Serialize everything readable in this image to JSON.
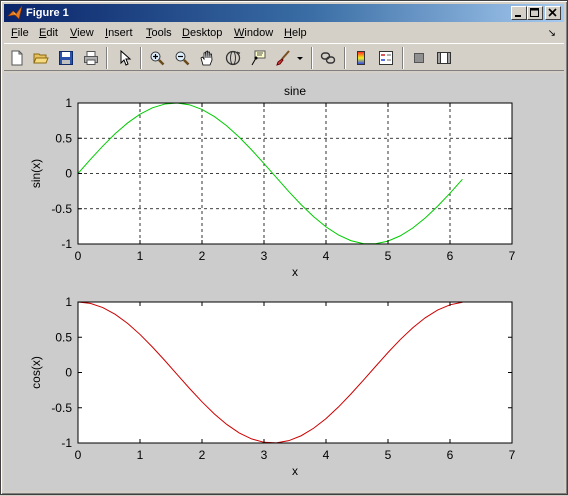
{
  "window": {
    "title": "Figure 1",
    "controls": {
      "minimize": "minimize",
      "maximize": "maximize",
      "close": "close"
    }
  },
  "menubar": {
    "items": [
      {
        "key": "F",
        "rest": "ile"
      },
      {
        "key": "E",
        "rest": "dit"
      },
      {
        "key": "V",
        "rest": "iew"
      },
      {
        "key": "I",
        "rest": "nsert"
      },
      {
        "key": "T",
        "rest": "ools"
      },
      {
        "key": "D",
        "rest": "esktop"
      },
      {
        "key": "W",
        "rest": "indow"
      },
      {
        "key": "H",
        "rest": "elp"
      }
    ],
    "arrow": "↘"
  },
  "toolbar": {
    "icons": [
      "new-file-icon",
      "open-folder-icon",
      "save-icon",
      "print-icon",
      "pointer-arrow-icon",
      "zoom-in-icon",
      "zoom-out-icon",
      "pan-hand-icon",
      "rotate-3d-icon",
      "data-cursor-icon",
      "brush-icon",
      "dropdown-arrow-icon",
      "link-plot-icon",
      "colorbar-icon",
      "legend-icon",
      "hide-plot-tools-icon",
      "show-plot-tools-icon"
    ]
  },
  "colors": {
    "sine": "#00cc00",
    "cosine": "#cc0000",
    "grid": "#000000",
    "figure_bg": "#cccccc"
  },
  "chart_data": [
    {
      "type": "line",
      "title": "sine",
      "xlabel": "x",
      "ylabel": "sin(x)",
      "xlim": [
        0,
        7
      ],
      "ylim": [
        -1,
        1
      ],
      "xticks": [
        "0",
        "1",
        "2",
        "3",
        "4",
        "5",
        "6",
        "7"
      ],
      "yticks": [
        "-1",
        "-0.5",
        "0",
        "0.5",
        "1"
      ],
      "grid": true,
      "series": [
        {
          "function": "sin",
          "x": [
            0,
            0.2,
            0.4,
            0.6,
            0.8,
            1.0,
            1.2,
            1.4,
            1.6,
            1.8,
            2.0,
            2.2,
            2.4,
            2.6,
            2.8,
            3.0,
            3.2,
            3.4,
            3.6,
            3.8,
            4.0,
            4.2,
            4.4,
            4.6,
            4.8,
            5.0,
            5.2,
            5.4,
            5.6,
            5.8,
            6.0,
            6.2
          ],
          "y": [
            0,
            0.199,
            0.389,
            0.565,
            0.717,
            0.841,
            0.932,
            0.985,
            1.0,
            0.974,
            0.909,
            0.808,
            0.675,
            0.516,
            0.335,
            0.141,
            -0.058,
            -0.256,
            -0.443,
            -0.612,
            -0.757,
            -0.872,
            -0.952,
            -0.994,
            -0.996,
            -0.959,
            -0.883,
            -0.773,
            -0.631,
            -0.465,
            -0.279,
            -0.083
          ]
        }
      ]
    },
    {
      "type": "line",
      "title": "",
      "xlabel": "x",
      "ylabel": "cos(x)",
      "xlim": [
        0,
        7
      ],
      "ylim": [
        -1,
        1
      ],
      "xticks": [
        "0",
        "1",
        "2",
        "3",
        "4",
        "5",
        "6",
        "7"
      ],
      "yticks": [
        "-1",
        "-0.5",
        "0",
        "0.5",
        "1"
      ],
      "grid": false,
      "series": [
        {
          "function": "cos",
          "x": [
            0,
            0.2,
            0.4,
            0.6,
            0.8,
            1.0,
            1.2,
            1.4,
            1.6,
            1.8,
            2.0,
            2.2,
            2.4,
            2.6,
            2.8,
            3.0,
            3.2,
            3.4,
            3.6,
            3.8,
            4.0,
            4.2,
            4.4,
            4.6,
            4.8,
            5.0,
            5.2,
            5.4,
            5.6,
            5.8,
            6.0,
            6.2
          ],
          "y": [
            1.0,
            0.98,
            0.921,
            0.825,
            0.697,
            0.54,
            0.362,
            0.17,
            -0.029,
            -0.227,
            -0.416,
            -0.589,
            -0.737,
            -0.857,
            -0.942,
            -0.99,
            -0.998,
            -0.967,
            -0.897,
            -0.791,
            -0.654,
            -0.49,
            -0.307,
            -0.112,
            0.087,
            0.284,
            0.469,
            0.635,
            0.776,
            0.886,
            0.96,
            0.997
          ]
        }
      ]
    }
  ]
}
